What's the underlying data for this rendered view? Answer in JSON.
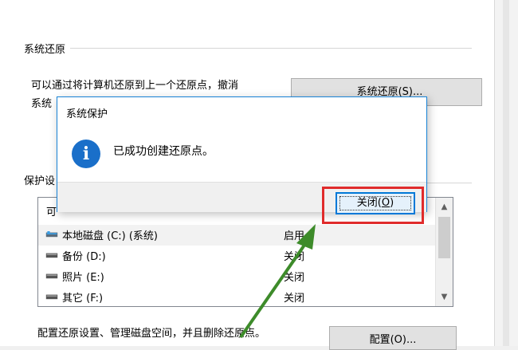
{
  "restore_group": {
    "label": "系统还原",
    "description_line1": "可以通过将计算机还原到上一个还原点，撤消",
    "description_line2": "系统",
    "button_label": "系统还原(S)..."
  },
  "protection_group": {
    "label": "保护设",
    "list_header": "可",
    "drives": [
      {
        "name": "本地磁盘 (C:) (系统)",
        "status": "启用",
        "icon": "system-drive-icon"
      },
      {
        "name": "备份 (D:)",
        "status": "关闭",
        "icon": "drive-icon"
      },
      {
        "name": "照片 (E:)",
        "status": "关闭",
        "icon": "drive-icon"
      },
      {
        "name": "其它 (F:)",
        "status": "关闭",
        "icon": "drive-icon"
      }
    ]
  },
  "configure": {
    "description": "配置还原设置、管理磁盘空间，并且删除还原点。",
    "button_label": "配置(O)..."
  },
  "dialog": {
    "title": "系统保护",
    "message": "已成功创建还原点。",
    "icon": "info-icon",
    "close_label": "关闭(O)",
    "close_label_main": "关闭(",
    "close_label_key": "O",
    "close_label_end": ")"
  },
  "colors": {
    "dialog_border": "#1883d7",
    "info_icon": "#1a6fc9",
    "highlight": "#e02b2b",
    "arrow": "#3d8b2a"
  }
}
